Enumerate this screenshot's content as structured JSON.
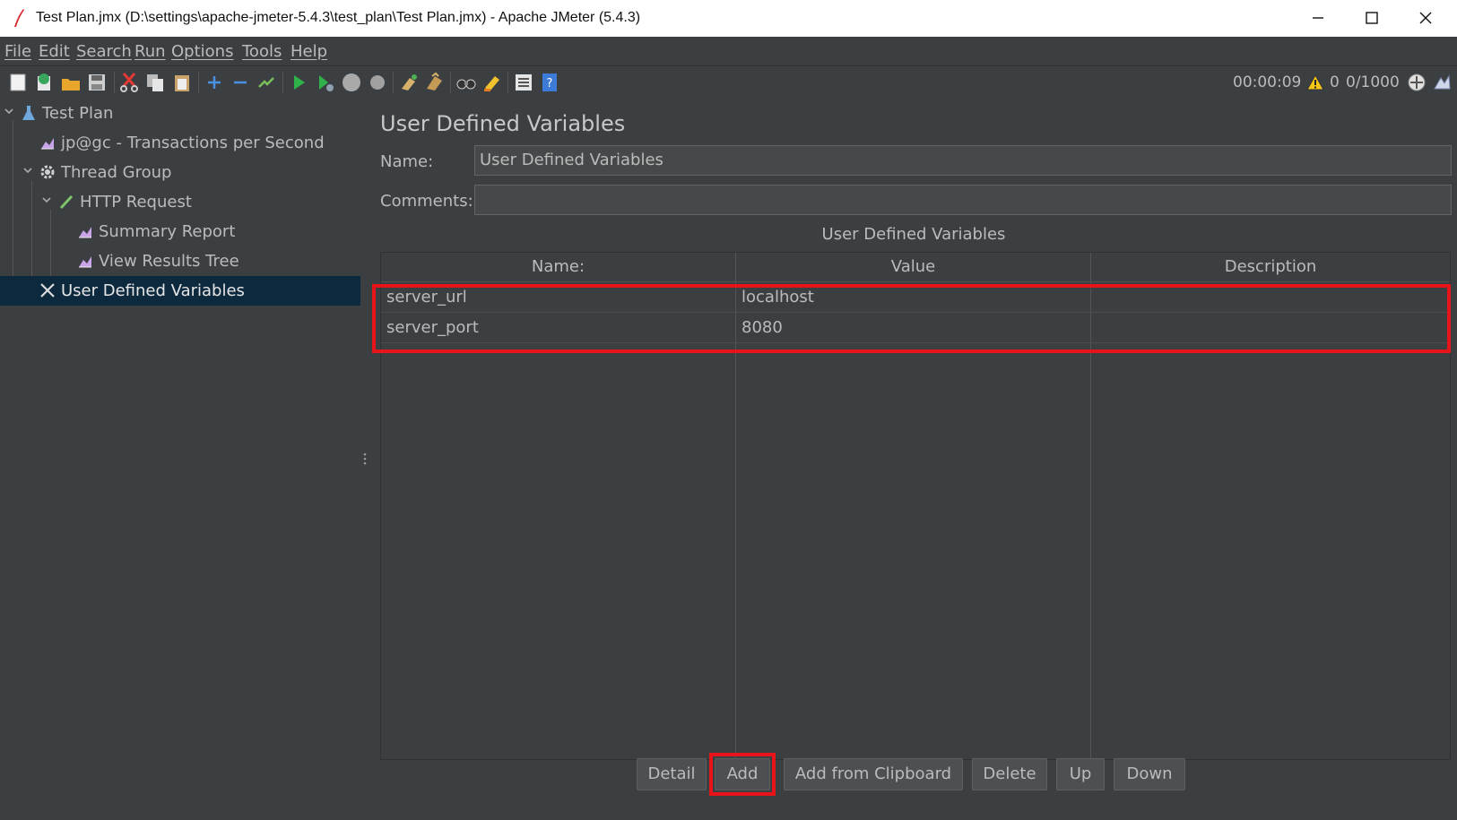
{
  "window": {
    "title": "Test Plan.jmx (D:\\settings\\apache-jmeter-5.4.3\\test_plan\\Test Plan.jmx) - Apache JMeter (5.4.3)",
    "icon": "feather-icon"
  },
  "menu": [
    "File",
    "Edit",
    "Search",
    "Run",
    "Options",
    "Tools",
    "Help"
  ],
  "toolbar": {
    "buttons": [
      "new-icon",
      "templates-icon",
      "open-icon",
      "save-icon",
      "cut-icon",
      "copy-icon",
      "paste-icon",
      "expand-icon",
      "collapse-icon",
      "toggle-icon",
      "start-icon",
      "start-no-pause-icon",
      "stop-icon",
      "shutdown-icon",
      "clear-icon",
      "clear-all-icon",
      "search-icon",
      "reset-search-icon",
      "function-helper-icon",
      "help-icon"
    ],
    "elapsed": "00:00:09",
    "warnings": "0",
    "threads": "0/1000"
  },
  "tree": {
    "items": [
      {
        "label": "Test Plan",
        "icon": "flask-icon"
      },
      {
        "label": "jp@gc - Transactions per Second",
        "icon": "graph-icon"
      },
      {
        "label": "Thread Group",
        "icon": "gear-icon"
      },
      {
        "label": "HTTP Request",
        "icon": "pen-icon"
      },
      {
        "label": "Summary Report",
        "icon": "graph-icon"
      },
      {
        "label": "View Results Tree",
        "icon": "graph-icon"
      },
      {
        "label": "User Defined Variables",
        "icon": "wrench-icon"
      }
    ]
  },
  "panel": {
    "title": "User Defined Variables",
    "name_label": "Name:",
    "name_value": "User Defined Variables",
    "comments_label": "Comments:",
    "comments_value": "",
    "table_caption": "User Defined Variables",
    "columns": [
      "Name:",
      "Value",
      "Description"
    ],
    "rows": [
      [
        "server_url",
        "localhost",
        ""
      ],
      [
        "server_port",
        "8080",
        ""
      ]
    ],
    "buttons": [
      "Detail",
      "Add",
      "Add from Clipboard",
      "Delete",
      "Up",
      "Down"
    ]
  },
  "annotation_color": "#e8141a"
}
